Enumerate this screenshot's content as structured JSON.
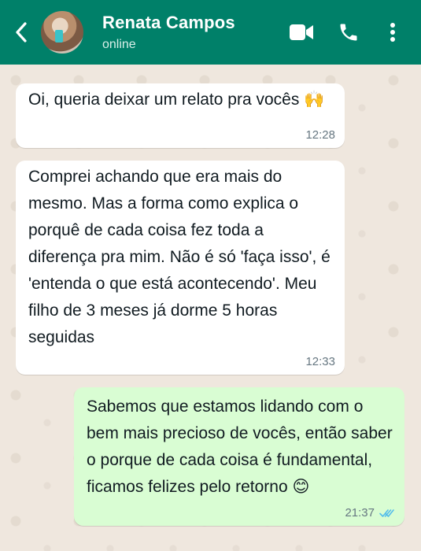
{
  "header": {
    "contact_name": "Renata Campos",
    "status": "online",
    "background_color": "#008069",
    "icons": [
      "back-arrow-icon",
      "avatar",
      "video-call-icon",
      "phone-icon",
      "more-vert-icon"
    ]
  },
  "messages": [
    {
      "direction": "incoming",
      "text": "Oi, queria deixar um relato pra vocês 🙌",
      "time": "12:28"
    },
    {
      "direction": "incoming",
      "text": "Comprei achando que era mais do mesmo. Mas a forma como explica o porquê de cada coisa fez toda a diferença pra mim. Não é só 'faça isso', é 'entenda o que está acontecendo'. Meu filho de 3 meses já dorme 5 horas seguidas",
      "time": "12:33"
    },
    {
      "direction": "outgoing",
      "text": "Sabemos que estamos lidando com o bem mais precioso de vocês, então saber o porque de cada coisa é fundamental, ficamos felizes pelo retorno 😊",
      "time": "21:37",
      "status": "read"
    }
  ],
  "colors": {
    "chat_background": "#efe7de",
    "outgoing_bubble": "#d9fdd3",
    "incoming_bubble": "#ffffff",
    "read_ticks": "#53bdeb"
  }
}
